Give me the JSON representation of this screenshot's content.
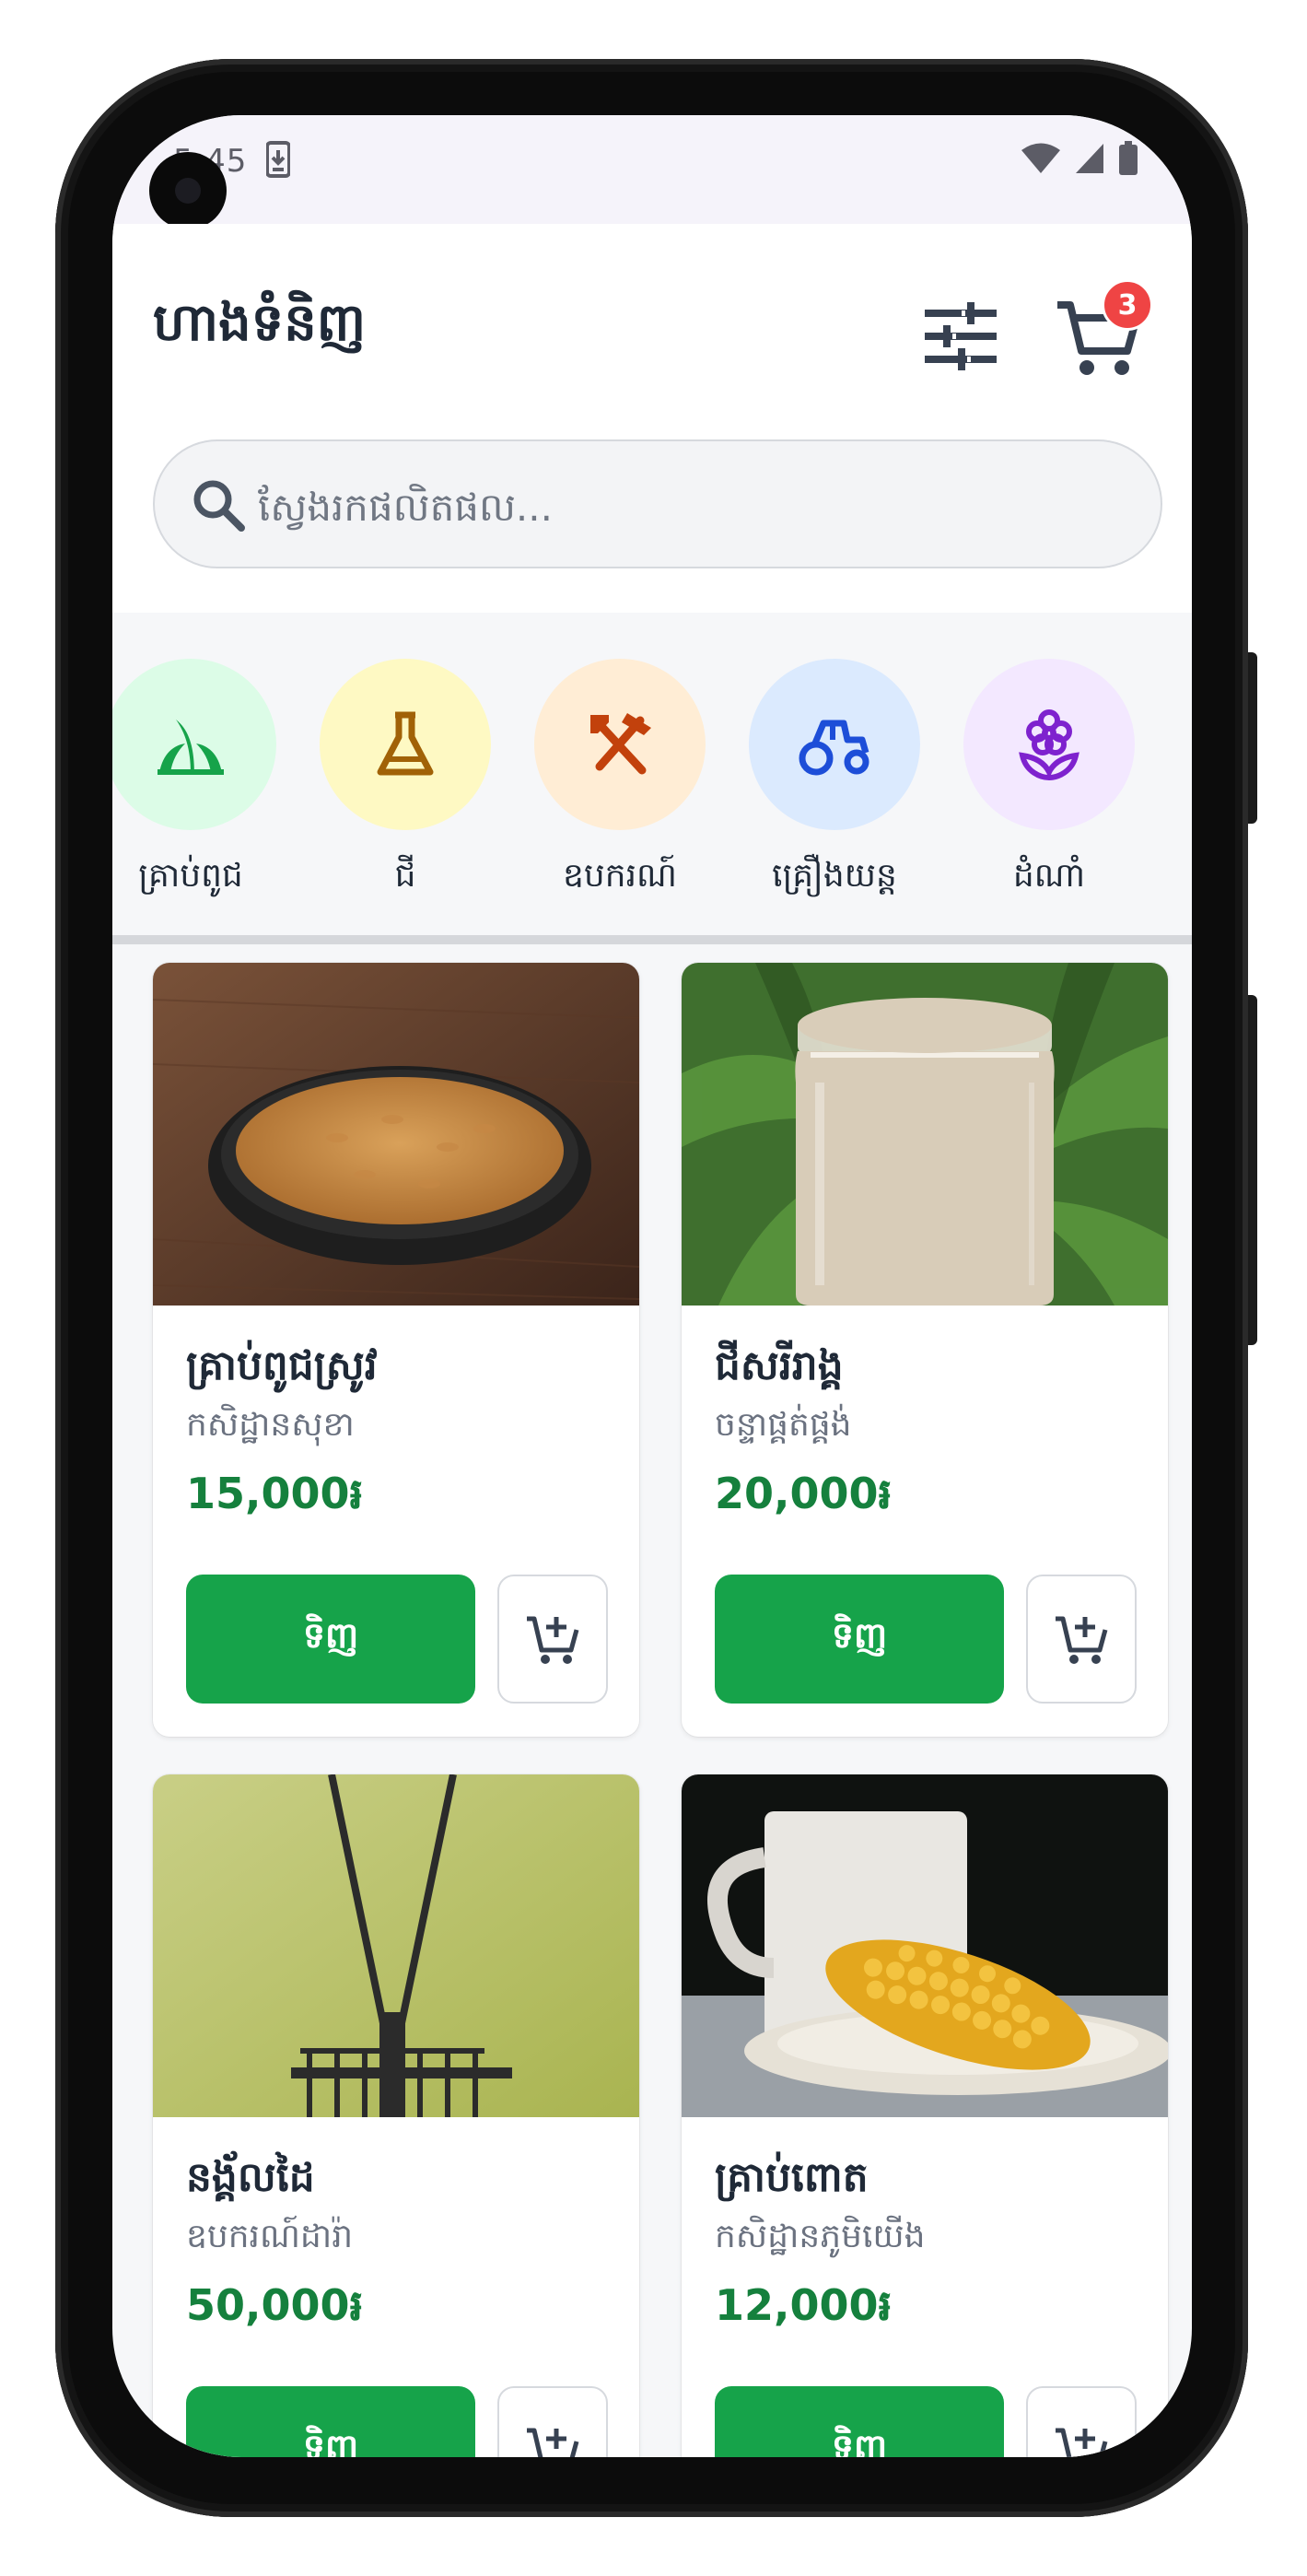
{
  "status_bar": {
    "time": "5:45"
  },
  "header": {
    "title": "ហាងទំនិញ",
    "cart_count": "3"
  },
  "search": {
    "placeholder": "ស្វែងរកផលិតផល..."
  },
  "categories": [
    {
      "label": "គ្រាប់ពូជ",
      "icon": "sprout-icon",
      "bg": "#dcfce7",
      "fg": "#16a34a"
    },
    {
      "label": "ជី",
      "icon": "flask-icon",
      "bg": "#fef9c3",
      "fg": "#a16207"
    },
    {
      "label": "ឧបករណ៍",
      "icon": "tools-icon",
      "bg": "#ffedd5",
      "fg": "#c2410c"
    },
    {
      "label": "គ្រឿងយន្ត",
      "icon": "tractor-icon",
      "bg": "#dbeafe",
      "fg": "#1d4ed8"
    },
    {
      "label": "ដំណាំ",
      "icon": "flower-icon",
      "bg": "#f3e8ff",
      "fg": "#7e22ce"
    }
  ],
  "products": [
    {
      "name": "គ្រាប់ពូជស្រូវ",
      "seller": "កសិដ្ឋានសុខា",
      "price": "15,000៛",
      "buy_label": "ទិញ"
    },
    {
      "name": "ជីសរីរាង្គ",
      "seller": "ចន្ទាផ្គត់ផ្គង់",
      "price": "20,000៛",
      "buy_label": "ទិញ"
    },
    {
      "name": "នង្គ័លដៃ",
      "seller": "ឧបករណ៍ដារ៉ា",
      "price": "50,000៛",
      "buy_label": "ទិញ"
    },
    {
      "name": "គ្រាប់ពោត",
      "seller": "កសិដ្ឋានភូមិយើង",
      "price": "12,000៛",
      "buy_label": "ទិញ"
    }
  ],
  "colors": {
    "accent": "#16a34a",
    "price": "#15803d",
    "badge": "#ef4444"
  }
}
